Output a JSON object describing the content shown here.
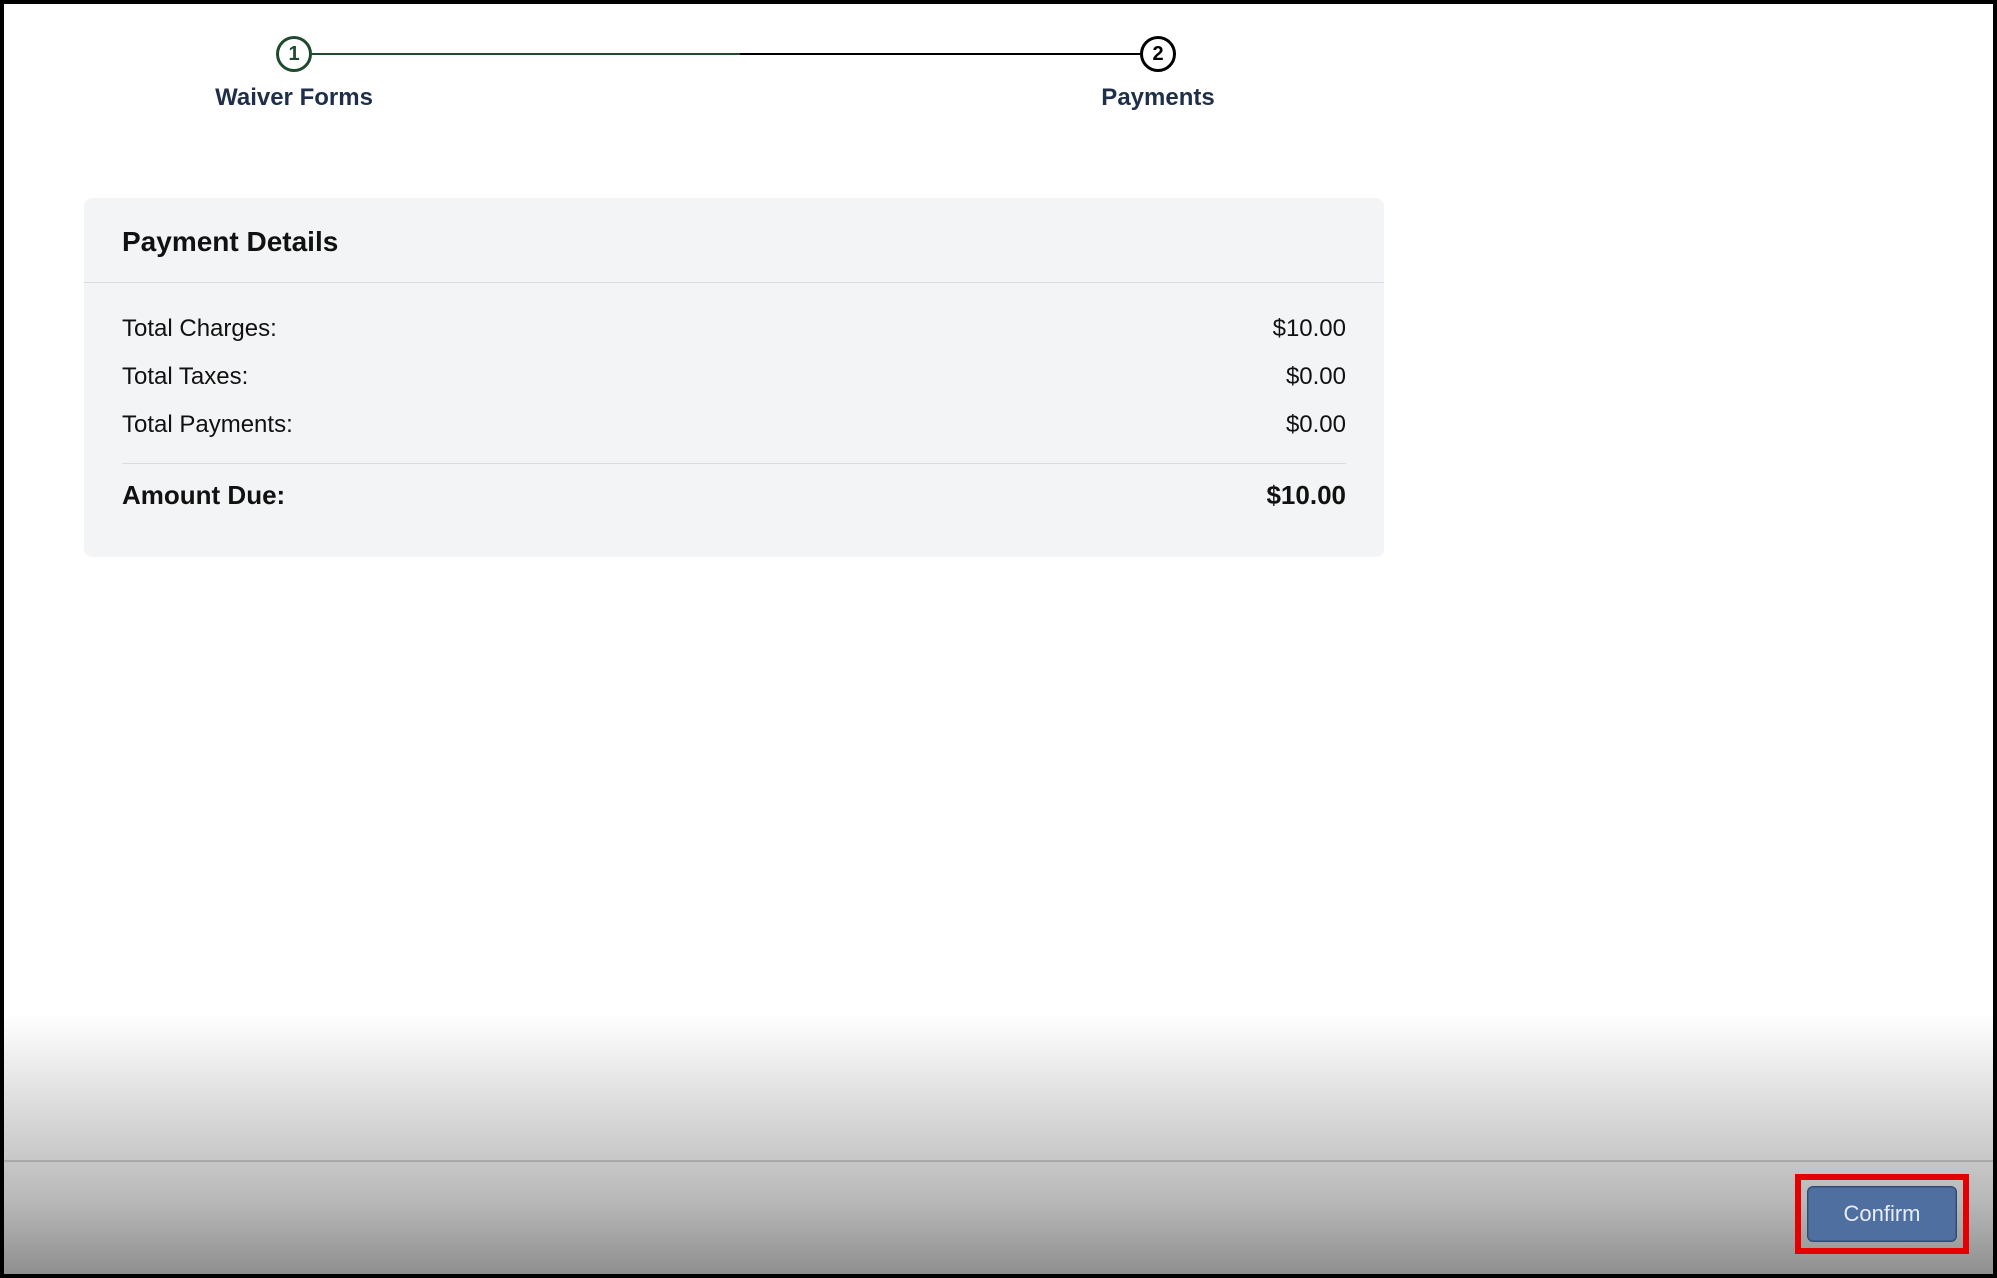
{
  "stepper": {
    "steps": [
      {
        "num": "1",
        "label": "Waiver Forms",
        "state": "done"
      },
      {
        "num": "2",
        "label": "Payments",
        "state": "current"
      }
    ]
  },
  "card": {
    "title": "Payment Details",
    "rows": [
      {
        "label": "Total Charges:",
        "value": "$10.00"
      },
      {
        "label": "Total Taxes:",
        "value": "$0.00"
      },
      {
        "label": "Total Payments:",
        "value": "$0.00"
      }
    ],
    "total": {
      "label": "Amount Due:",
      "value": "$10.00"
    }
  },
  "footer": {
    "confirm_label": "Confirm",
    "confirm_highlighted": true
  },
  "colors": {
    "step_done": "#1f4a2e",
    "step_pending": "#000000",
    "card_bg": "#f3f4f6",
    "button_bg": "#4f6fa0",
    "highlight_border": "#e40000"
  }
}
